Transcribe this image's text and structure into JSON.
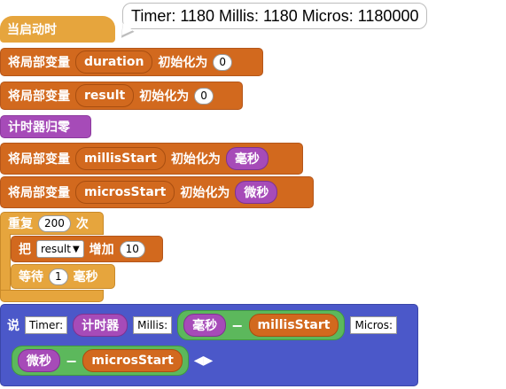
{
  "bubble": {
    "text": "Timer: 1180 Millis: 1180 Micros: 1180000"
  },
  "hat": {
    "label": "当启动时"
  },
  "blocks": [
    {
      "label": "将局部变量",
      "var": "duration",
      "suffix": "初始化为",
      "value": "0"
    },
    {
      "label": "将局部变量",
      "var": "result",
      "suffix": "初始化为",
      "value": "0"
    },
    {
      "label": "计时器归零"
    },
    {
      "label": "将局部变量",
      "var": "millisStart",
      "suffix": "初始化为",
      "value": "毫秒"
    },
    {
      "label": "将局部变量",
      "var": "microsStart",
      "suffix": "初始化为",
      "value": "微秒"
    }
  ],
  "repeat": {
    "label": "重复",
    "count": "200",
    "suffix": "次",
    "change": {
      "prefix": "把",
      "var": "result",
      "op": "增加",
      "amount": "10"
    },
    "wait": {
      "prefix": "等待",
      "amount": "1",
      "unit": "毫秒"
    }
  },
  "say": {
    "label": "说",
    "timer_label": "Timer:",
    "timer_value": "计时器",
    "millis_label": "Millis:",
    "millis_left": "毫秒",
    "minus": "−",
    "millis_right": "millisStart",
    "micros_label": "Micros:",
    "micros_left": "微秒",
    "micros_right": "microsStart"
  },
  "colors": {
    "events": "#e6a53d",
    "variables": "#d2691e",
    "timer": "#a64bb8",
    "looks": "#4b58c9",
    "operators": "#5cb85c"
  }
}
